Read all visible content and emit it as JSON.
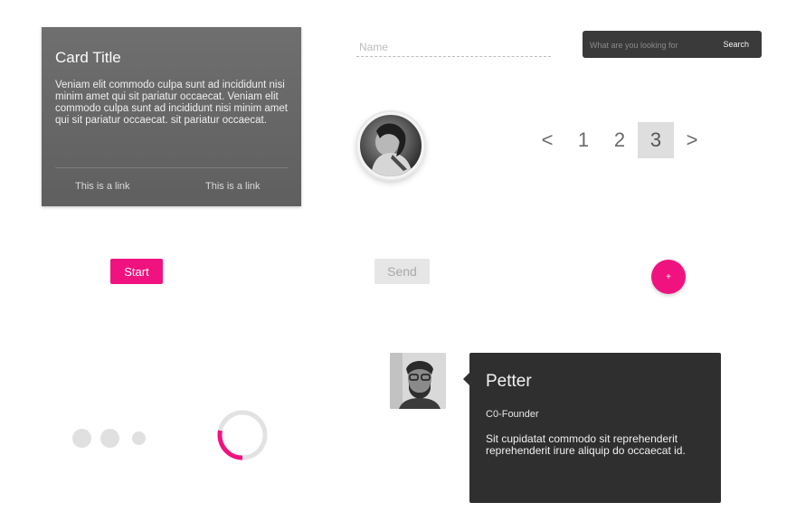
{
  "card": {
    "title": "Card Title",
    "body": "Veniam elit commodo culpa sunt ad incididunt nisi minim amet qui sit pariatur occaecat. Veniam elit commodo culpa sunt ad incididunt nisi minim amet qui sit pariatur occaecat. sit pariatur occaecat.",
    "link1": "This is a link",
    "link2": "This is a link"
  },
  "name_field": {
    "placeholder": "Name",
    "value": ""
  },
  "search": {
    "placeholder": "What are you looking for",
    "button_label": "Search"
  },
  "pagination": {
    "prev": "<",
    "next": ">",
    "pages": [
      "1",
      "2",
      "3"
    ],
    "current": "3"
  },
  "buttons": {
    "start_label": "Start",
    "send_label": "Send",
    "fab_label": "+"
  },
  "spinner": {
    "color": "#f0137f",
    "track_color": "#e2e2e2"
  },
  "colors": {
    "accent": "#f0137f",
    "card_bg": "#666666",
    "dark_panel": "#2f2f2f"
  },
  "profile": {
    "name": "Petter",
    "role": "C0-Founder",
    "bio": "Sit cupidatat commodo sit reprehenderit reprehenderit irure aliquip do occaecat id."
  }
}
